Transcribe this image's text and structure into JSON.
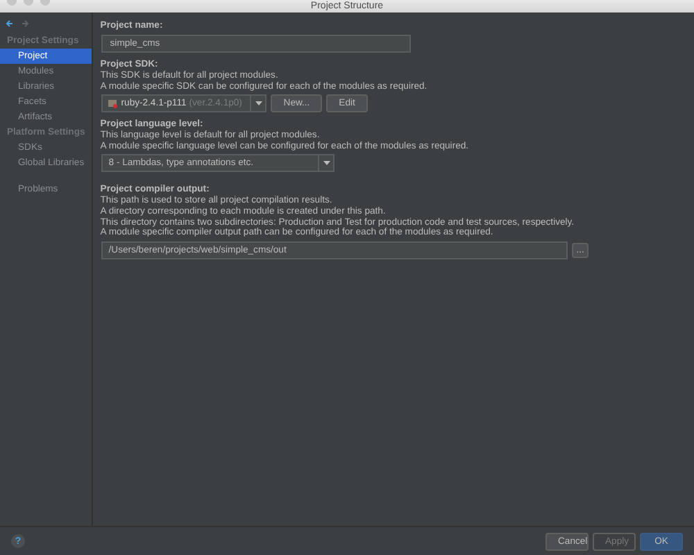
{
  "window": {
    "title": "Project Structure"
  },
  "sidebar": {
    "groups": [
      {
        "heading": "Project Settings",
        "items": [
          {
            "label": "Project",
            "selected": true
          },
          {
            "label": "Modules",
            "selected": false
          },
          {
            "label": "Libraries",
            "selected": false
          },
          {
            "label": "Facets",
            "selected": false
          },
          {
            "label": "Artifacts",
            "selected": false
          }
        ]
      },
      {
        "heading": "Platform Settings",
        "items": [
          {
            "label": "SDKs",
            "selected": false
          },
          {
            "label": "Global Libraries",
            "selected": false
          }
        ]
      },
      {
        "items": [
          {
            "label": "Problems",
            "selected": false
          }
        ]
      }
    ]
  },
  "project_name": {
    "label": "Project name:",
    "value": "simple_cms"
  },
  "project_sdk": {
    "label": "Project SDK:",
    "description": [
      "This SDK is default for all project modules.",
      "A module specific SDK can be configured for each of the modules as required."
    ],
    "sdk_name": "ruby-2.4.1-p111",
    "sdk_version": "(ver.2.4.1p0)",
    "buttons": [
      "New...",
      "Edit"
    ]
  },
  "language_level": {
    "label": "Project language level:",
    "description": [
      "This language level is default for all project modules.",
      "A module specific language level can be configured for each of the modules as required."
    ],
    "value": "8 - Lambdas, type annotations etc."
  },
  "compiler_output": {
    "label": "Project compiler output:",
    "description": [
      "This path is used to store all project compilation results.",
      "A directory corresponding to each module is created under this path.",
      "This directory contains two subdirectories: Production and Test for production code and test sources, respectively.",
      "A module specific compiler output path can be configured for each of the modules as required."
    ],
    "value": "/Users/beren/projects/web/simple_cms/out",
    "browse": "..."
  },
  "footer": {
    "help": "?",
    "buttons": [
      {
        "label": "Cancel",
        "kind": "normal",
        "disabled": false
      },
      {
        "label": "Apply",
        "kind": "normal",
        "disabled": true
      },
      {
        "label": "OK",
        "kind": "default",
        "disabled": false
      }
    ]
  }
}
